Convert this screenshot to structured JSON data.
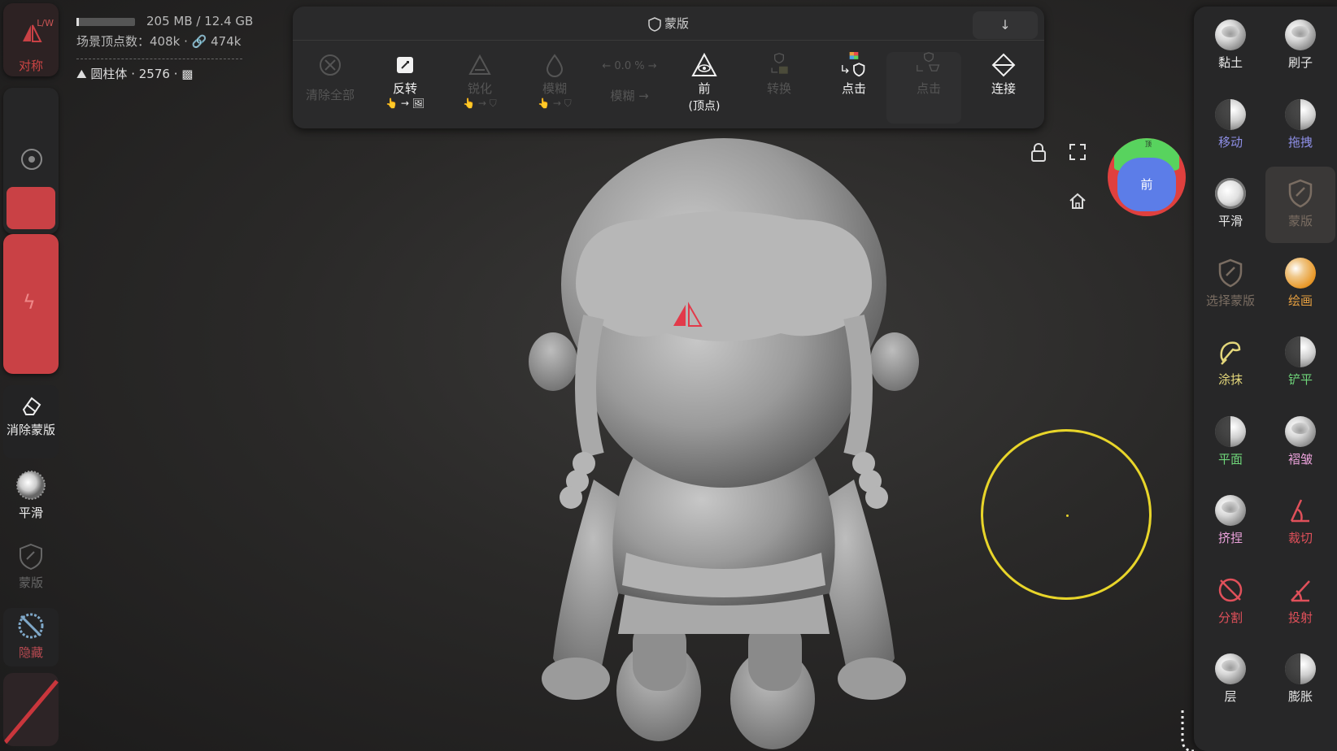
{
  "app": {
    "accent": "#c94145",
    "brush_color": "#e8d52a"
  },
  "left_toolbar": {
    "symmetry": {
      "label": "对称",
      "lw": "L/W",
      "icon": "symmetry-icon"
    },
    "erase_mask": {
      "label": "消除蒙版",
      "icon": "eraser-icon"
    },
    "smooth": {
      "label": "平滑",
      "icon": "smooth-ball-icon"
    },
    "mask": {
      "label": "蒙版",
      "icon": "mask-shield-icon"
    },
    "hide": {
      "label": "隐藏",
      "icon": "hide-icon"
    }
  },
  "info": {
    "memory": "205 MB / 12.4 GB",
    "vertex_label": "场景顶点数：",
    "vertex_count": "408k",
    "link_count": "474k",
    "object_name": "圆柱体",
    "object_count": "2576"
  },
  "top_toolbar": {
    "title": "蒙版",
    "collapse_icon": "↓",
    "tools": [
      {
        "label": "清除全部",
        "sub": "",
        "icon": "clear-all-icon",
        "enabled": false
      },
      {
        "label": "反转",
        "sub": "👆 → 🖼",
        "icon": "invert-icon",
        "enabled": true
      },
      {
        "label": "锐化",
        "sub": "👆 → ⛉",
        "icon": "sharpen-icon",
        "enabled": false
      },
      {
        "label": "模糊",
        "sub": "👆 → ⛉",
        "icon": "blur-icon",
        "enabled": false
      },
      {
        "label": "模糊 →",
        "sub": "← 0.0 % →",
        "icon": "blur-amount-icon",
        "enabled": false
      },
      {
        "label": "前",
        "sub": "(顶点)",
        "icon": "front-vertex-icon",
        "enabled": true
      },
      {
        "label": "转换",
        "sub": "",
        "icon": "convert-icon",
        "enabled": false
      },
      {
        "label": "点击",
        "sub": "",
        "icon": "click-color-icon",
        "enabled": true
      },
      {
        "label": "点击",
        "sub": "",
        "icon": "click-mask-icon",
        "enabled": false
      },
      {
        "label": "连接",
        "sub": "",
        "icon": "connect-icon",
        "enabled": true
      }
    ]
  },
  "viewport": {
    "lock_icon": "lock-icon",
    "fullscreen_icon": "fullscreen-icon",
    "home_icon": "home-icon",
    "gizmo_front": "前",
    "gizmo_top": "顶"
  },
  "right_panel": {
    "tools": [
      {
        "label": "黏土",
        "color": "#e8e8e8",
        "icon": "clay-icon"
      },
      {
        "label": "刷子",
        "color": "#e8e8e8",
        "icon": "brush-icon"
      },
      {
        "label": "移动",
        "color": "#8e8fe6",
        "icon": "move-icon"
      },
      {
        "label": "拖拽",
        "color": "#8e8fe6",
        "icon": "drag-icon"
      },
      {
        "label": "平滑",
        "color": "#e8e8e8",
        "icon": "smooth-icon"
      },
      {
        "label": "蒙版",
        "color": "#7a6d62",
        "icon": "mask-icon"
      },
      {
        "label": "选择蒙版",
        "color": "#7a6d62",
        "icon": "select-mask-icon"
      },
      {
        "label": "绘画",
        "color": "#e7a040",
        "icon": "paint-icon"
      },
      {
        "label": "涂抹",
        "color": "#e3d67a",
        "icon": "smudge-icon"
      },
      {
        "label": "铲平",
        "color": "#6fd67a",
        "icon": "flatten-icon"
      },
      {
        "label": "平面",
        "color": "#6fd67a",
        "icon": "plane-icon"
      },
      {
        "label": "褶皱",
        "color": "#e8a0d8",
        "icon": "crease-icon"
      },
      {
        "label": "挤捏",
        "color": "#e8a0d8",
        "icon": "pinch-icon"
      },
      {
        "label": "裁切",
        "color": "#e0505a",
        "icon": "trim-icon"
      },
      {
        "label": "分割",
        "color": "#e0505a",
        "icon": "split-icon"
      },
      {
        "label": "投射",
        "color": "#e0505a",
        "icon": "project-icon"
      },
      {
        "label": "层",
        "color": "#e8e8e8",
        "icon": "layer-icon"
      },
      {
        "label": "膨胀",
        "color": "#e8e8e8",
        "icon": "inflate-icon"
      }
    ]
  }
}
